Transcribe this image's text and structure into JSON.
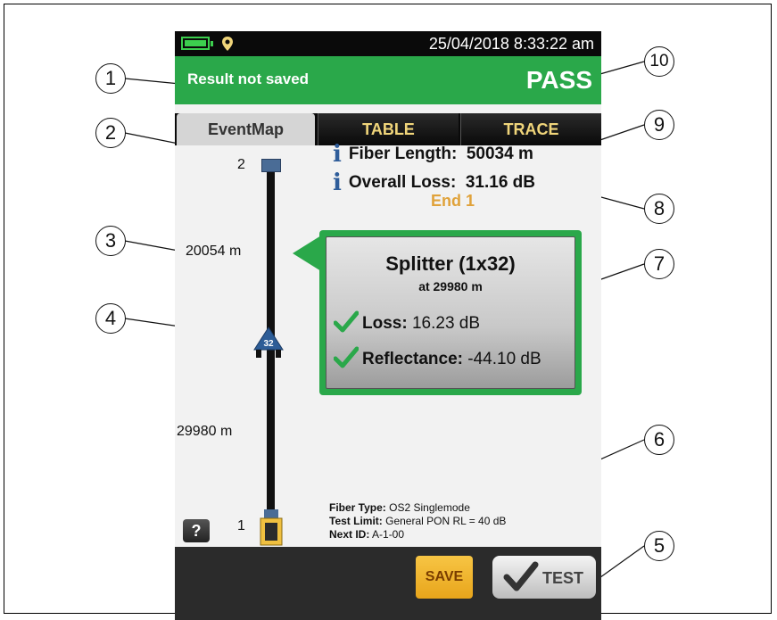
{
  "statusbar": {
    "datetime": "25/04/2018 8:33:22 am",
    "battery_icon": "battery-full-icon",
    "location_icon": "location-pin-icon"
  },
  "result": {
    "save_status": "Result not saved",
    "verdict": "PASS",
    "color": "#2aa84a"
  },
  "tabs": [
    {
      "label": "EventMap",
      "active": true
    },
    {
      "label": "TABLE",
      "active": false
    },
    {
      "label": "TRACE",
      "active": false
    }
  ],
  "map": {
    "end2_label": "2",
    "end1_label": "1",
    "segment1_length": "20054 m",
    "segment2_length": "29980 m",
    "splitter_badge": "32"
  },
  "summary": {
    "fiber_length_label": "Fiber Length:",
    "fiber_length_value": "50034 m",
    "overall_loss_label": "Overall Loss:",
    "overall_loss_value": "31.16 dB",
    "end_label": "End 1"
  },
  "event": {
    "title": "Splitter (1x32)",
    "position": "at 29980 m",
    "loss_label": "Loss:",
    "loss_value": "16.23 dB",
    "reflectance_label": "Reflectance:",
    "reflectance_value": "-44.10 dB"
  },
  "test_info": {
    "fiber_type_label": "Fiber Type:",
    "fiber_type_value": "OS2 Singlemode",
    "test_limit_label": "Test Limit:",
    "test_limit_value": "General PON RL = 40 dB",
    "next_id_label": "Next ID:",
    "next_id_value": "A-1-00"
  },
  "buttons": {
    "help": "?",
    "save": "SAVE",
    "test": "TEST"
  },
  "callouts": [
    "1",
    "2",
    "3",
    "4",
    "5",
    "6",
    "7",
    "8",
    "9",
    "10"
  ]
}
